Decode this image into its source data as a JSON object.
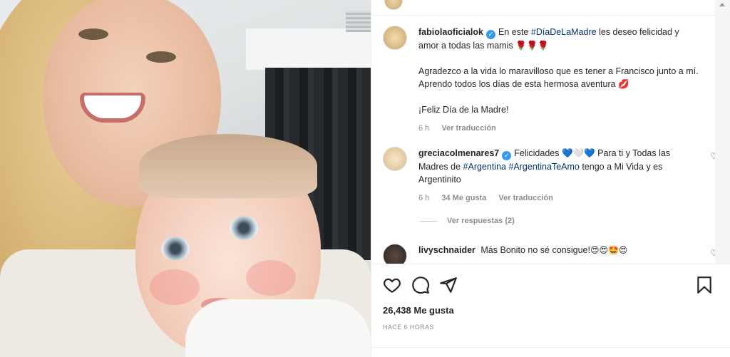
{
  "post": {
    "caption": {
      "username": "fabiolaoficialok",
      "line1_prefix": "En este ",
      "hashtag": "#DíaDeLaMadre",
      "line1_suffix": " les deseo felicidad y amor a todas las mamis ",
      "roses": "🌹🌹🌹",
      "paragraph2": "Agradezco a la vida lo maravilloso que es tener a Francisco junto a mí. Aprendo todos los días de esta hermosa aventura ",
      "lips": "💋",
      "paragraph3": "¡Feliz Día de la Madre!",
      "time": "6 h",
      "translate": "Ver traducción"
    },
    "comments": [
      {
        "username": "greciacolmenares7",
        "text_prefix": "Felicidades ",
        "hearts": "💙🤍💙",
        "text_mid": " Para ti y Todas las Madres de ",
        "hashtag1": "#Argentina",
        "hashtag2": "#ArgentinaTeAmo",
        "text_suffix": " tengo a Mi Vida y es Argentinito",
        "time": "6 h",
        "likes": "34 Me gusta",
        "translate": "Ver traducción",
        "replies": "Ver respuestas (2)"
      },
      {
        "username": "livyschnaider",
        "text": "Más Bonito no sé consigue!",
        "emojis": "😍😍🤩😍"
      }
    ],
    "like_count": "26,438 Me gusta",
    "posted_ago": "HACE 6 HORAS"
  },
  "icons": {
    "like": "heart-icon",
    "comment": "comment-icon",
    "share": "send-icon",
    "save": "bookmark-icon",
    "comment_like": "heart-icon"
  },
  "colors": {
    "hashtag": "#00376b",
    "verified": "#3897f0",
    "muted": "#8e8e8e",
    "text": "#262626"
  }
}
